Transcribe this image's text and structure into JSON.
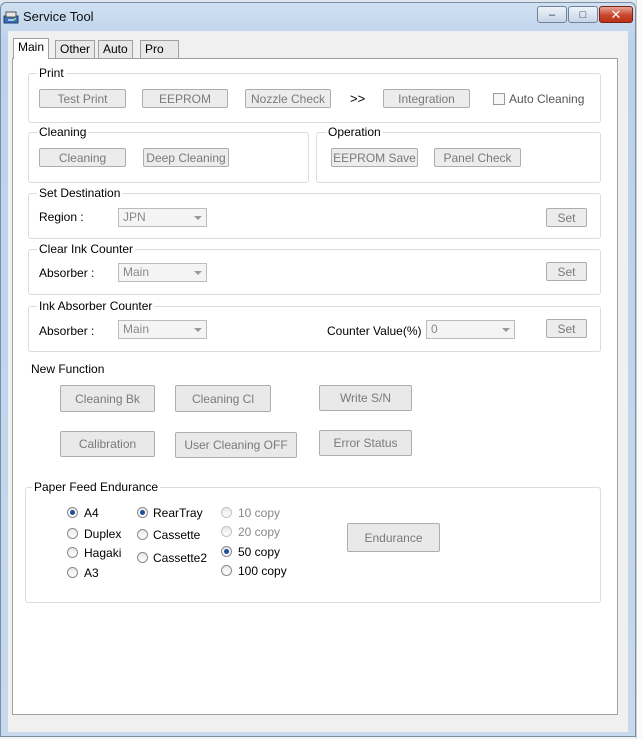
{
  "window": {
    "title": "Service Tool",
    "minimize_glyph": "–",
    "maximize_glyph": "□",
    "close_glyph": "✕"
  },
  "tabs": [
    {
      "label": "Main"
    },
    {
      "label": "Other"
    },
    {
      "label": "Auto"
    },
    {
      "label": "Pro"
    }
  ],
  "print": {
    "label": "Print",
    "test_print": "Test Print",
    "eeprom": "EEPROM",
    "nozzle_check": "Nozzle Check",
    "chevron": ">>",
    "integration": "Integration",
    "auto_cleaning": "Auto Cleaning"
  },
  "cleaning": {
    "label": "Cleaning",
    "cleaning": "Cleaning",
    "deep_cleaning": "Deep Cleaning"
  },
  "operation": {
    "label": "Operation",
    "eeprom_save": "EEPROM Save",
    "panel_check": "Panel Check"
  },
  "set_destination": {
    "label": "Set Destination",
    "region_label": "Region :",
    "region_value": "JPN",
    "set": "Set"
  },
  "clear_ink_counter": {
    "label": "Clear Ink Counter",
    "absorber_label": "Absorber :",
    "absorber_value": "Main",
    "set": "Set"
  },
  "ink_absorber_counter": {
    "label": "Ink Absorber Counter",
    "absorber_label": "Absorber :",
    "absorber_value": "Main",
    "counter_label": "Counter Value(%) :",
    "counter_value": "0",
    "set": "Set"
  },
  "new_function": {
    "label": "New Function",
    "cleaning_bk": "Cleaning Bk",
    "cleaning_cl": "Cleaning Cl",
    "write_sn": "Write S/N",
    "calibration": "Calibration",
    "user_cleaning_off": "User Cleaning OFF",
    "error_status": "Error Status"
  },
  "paper_feed": {
    "label": "Paper Feed Endurance",
    "sizes": [
      "A4",
      "Duplex",
      "Hagaki",
      "A3"
    ],
    "sources": [
      "RearTray",
      "Cassette",
      "Cassette2"
    ],
    "copies": [
      "10 copy",
      "20 copy",
      "50 copy",
      "100 copy"
    ],
    "endurance": "Endurance",
    "selected_size": "A4",
    "selected_source": "RearTray",
    "selected_copies": "50 copy"
  },
  "colors": {
    "accent": "#1f4e9a",
    "disabled_text": "#7a7a7a"
  }
}
